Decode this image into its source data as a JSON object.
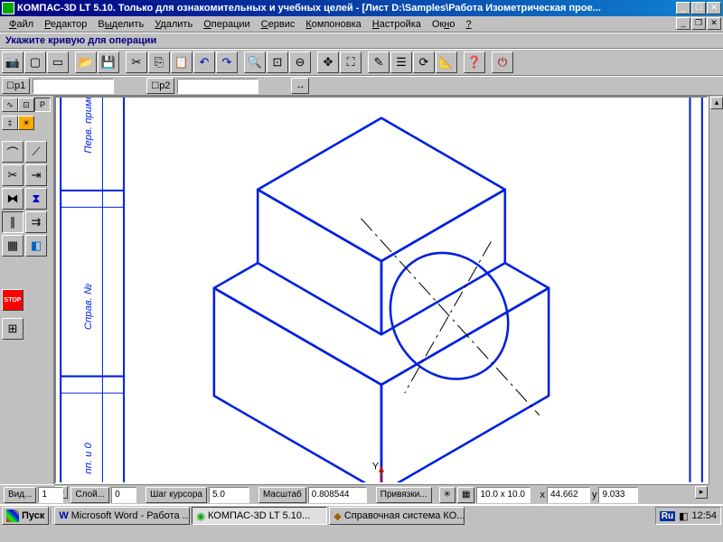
{
  "title": "КОМПАС-3D LT 5.10. Только для ознакомительных и учебных целей - [Лист D:\\Samples\\Работа Изометрическая прое...",
  "menus": [
    "Файл",
    "Редактор",
    "Выделить",
    "Удалить",
    "Операции",
    "Сервис",
    "Компоновка",
    "Настройка",
    "Окно",
    "?"
  ],
  "hint": "Укажите кривую для операции",
  "proprow": {
    "p1": "p1",
    "p2": "p2"
  },
  "status": {
    "view_label": "Вид...",
    "view": "1",
    "layer_label": "Слой...",
    "layer": "0",
    "step_label": "Шаг курсора",
    "step": "5.0",
    "scale_label": "Масштаб",
    "scale": "0.808544",
    "snap_label": "Привязки...",
    "grid": "10.0 x 10.0",
    "x_label": "x",
    "x": "44.662",
    "y_label": "y",
    "y": "9.033"
  },
  "taskbar": {
    "start": "Пуск",
    "tasks": [
      "Microsoft Word - Работа ...",
      "КОМПАС-3D LT 5.10...",
      "Справочная система КО..."
    ],
    "lang": "Ru",
    "clock": "12:54"
  },
  "left_labels": {
    "top": "Перв. приме",
    "mid": "Справ. №",
    "bot": "пп. и 0"
  }
}
